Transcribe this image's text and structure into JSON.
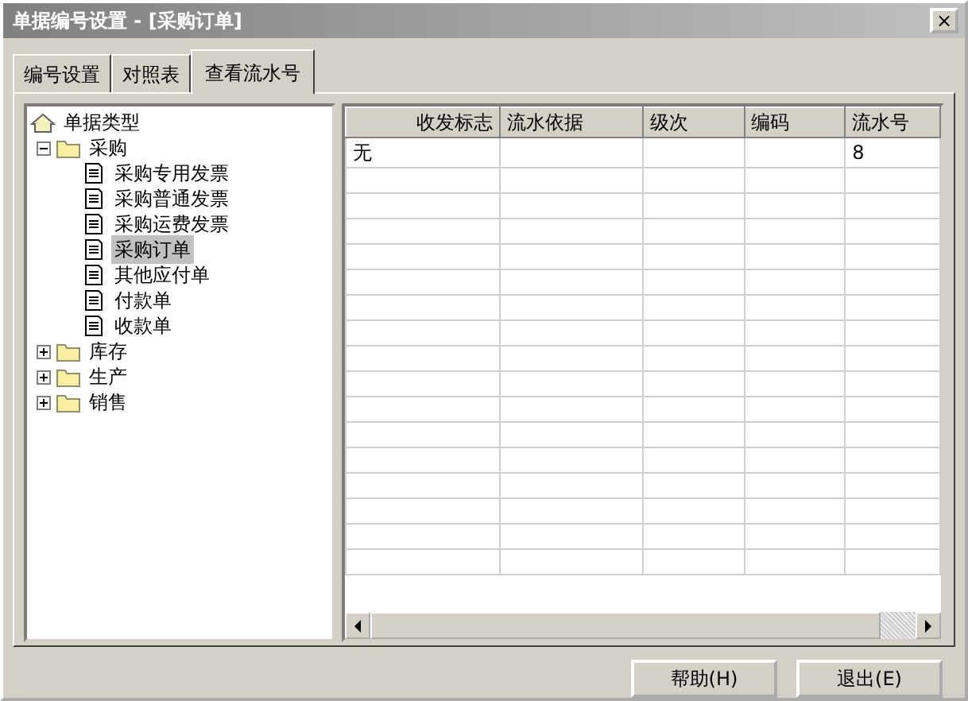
{
  "window": {
    "title": "单据编号设置 - [采购订单]",
    "close": "×"
  },
  "tabs": [
    {
      "label": "编号设置",
      "selected": false
    },
    {
      "label": "对照表",
      "selected": false
    },
    {
      "label": "查看流水号",
      "selected": true
    }
  ],
  "tree": [
    {
      "label": "单据类型",
      "kind": "root",
      "selected": false,
      "children": [
        {
          "label": "采购",
          "kind": "folder",
          "expanded": true,
          "selected": false,
          "children": [
            {
              "label": "采购专用发票",
              "kind": "doc",
              "selected": false
            },
            {
              "label": "采购普通发票",
              "kind": "doc",
              "selected": false
            },
            {
              "label": "采购运费发票",
              "kind": "doc",
              "selected": false
            },
            {
              "label": "采购订单",
              "kind": "doc",
              "selected": true
            },
            {
              "label": "其他应付单",
              "kind": "doc",
              "selected": false
            },
            {
              "label": "付款单",
              "kind": "doc",
              "selected": false
            },
            {
              "label": "收款单",
              "kind": "doc",
              "selected": false
            }
          ]
        },
        {
          "label": "库存",
          "kind": "folder",
          "expanded": false,
          "selected": false
        },
        {
          "label": "生产",
          "kind": "folder",
          "expanded": false,
          "selected": false
        },
        {
          "label": "销售",
          "kind": "folder",
          "expanded": false,
          "selected": false
        }
      ]
    }
  ],
  "table": {
    "columns": [
      "收发标志",
      "流水依据",
      "级次",
      "编码",
      "流水号"
    ],
    "rows": [
      [
        "无",
        "",
        "",
        "",
        "8"
      ]
    ]
  },
  "buttons": [
    "帮助(H)",
    "退出(E)"
  ]
}
